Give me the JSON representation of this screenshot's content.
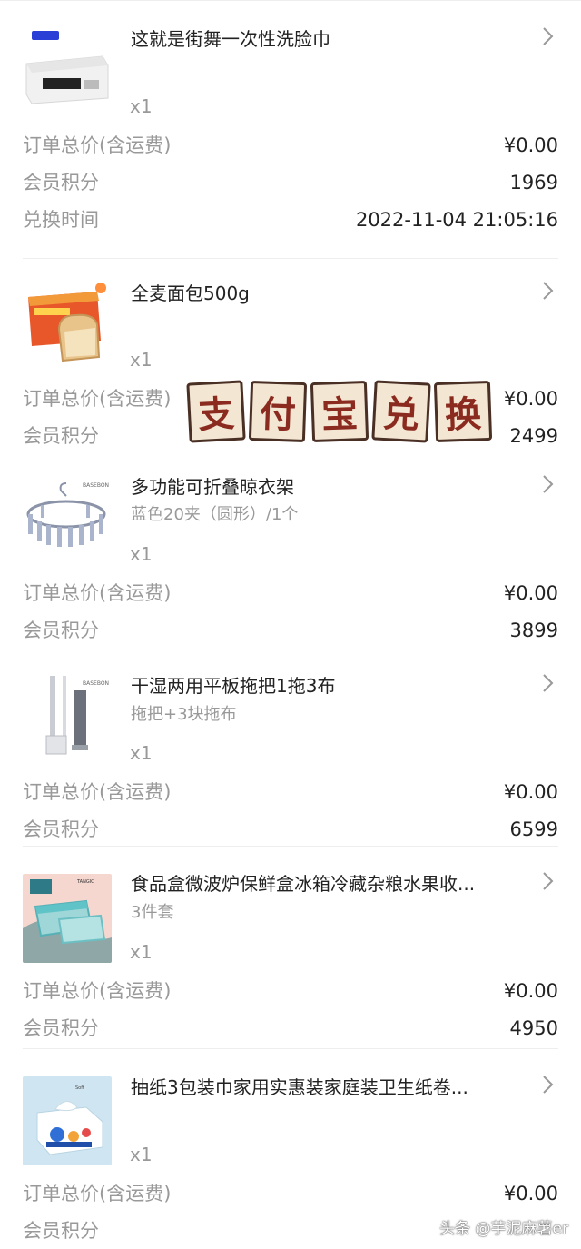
{
  "orders": [
    {
      "name": "这就是街舞一次性洗脸巾",
      "spec": "",
      "qty": "x1",
      "thumb_icon": "face-towel-package-image",
      "rows": [
        {
          "label": "订单总价(含运费)",
          "value": "¥0.00"
        },
        {
          "label": "会员积分",
          "value": "1969"
        },
        {
          "label": "兑换时间",
          "value": "2022-11-04 21:05:16"
        }
      ]
    },
    {
      "name": "全麦面包500g",
      "spec": "",
      "qty": "x1",
      "thumb_icon": "bread-box-image",
      "rows": [
        {
          "label": "订单总价(含运费)",
          "value": "¥0.00"
        },
        {
          "label": "会员积分",
          "value": "2499"
        }
      ]
    },
    {
      "name": "多功能可折叠晾衣架",
      "spec": "蓝色20夹（圆形）/1个",
      "qty": "x1",
      "thumb_icon": "clothes-hanger-image",
      "rows": [
        {
          "label": "订单总价(含运费)",
          "value": "¥0.00"
        },
        {
          "label": "会员积分",
          "value": "3899"
        }
      ]
    },
    {
      "name": "干湿两用平板拖把1拖3布",
      "spec": "拖把+3块拖布",
      "qty": "x1",
      "thumb_icon": "flat-mop-image",
      "rows": [
        {
          "label": "订单总价(含运费)",
          "value": "¥0.00"
        },
        {
          "label": "会员积分",
          "value": "6599"
        }
      ]
    },
    {
      "name": "食品盒微波炉保鲜盒冰箱冷藏杂粮水果收...",
      "spec": "3件套",
      "qty": "x1",
      "thumb_icon": "food-container-image",
      "rows": [
        {
          "label": "订单总价(含运费)",
          "value": "¥0.00"
        },
        {
          "label": "会员积分",
          "value": "4950"
        }
      ]
    },
    {
      "name": "抽纸3包装巾家用实惠装家庭装卫生纸卷...",
      "spec": "",
      "qty": "x1",
      "thumb_icon": "tissue-box-image",
      "rows": [
        {
          "label": "订单总价(含运费)",
          "value": "¥0.00"
        },
        {
          "label": "会员积分",
          "value": ""
        }
      ]
    }
  ],
  "overlay": {
    "chars": [
      "支",
      "付",
      "宝",
      "兑",
      "换"
    ]
  },
  "watermark": "头条 @芋泥麻薯er",
  "colors": {
    "text_primary": "#222222",
    "text_secondary": "#999999",
    "divider": "#eeeeee",
    "stamp_text": "#8b2a1e",
    "stamp_bg": "#f3e7d4"
  }
}
